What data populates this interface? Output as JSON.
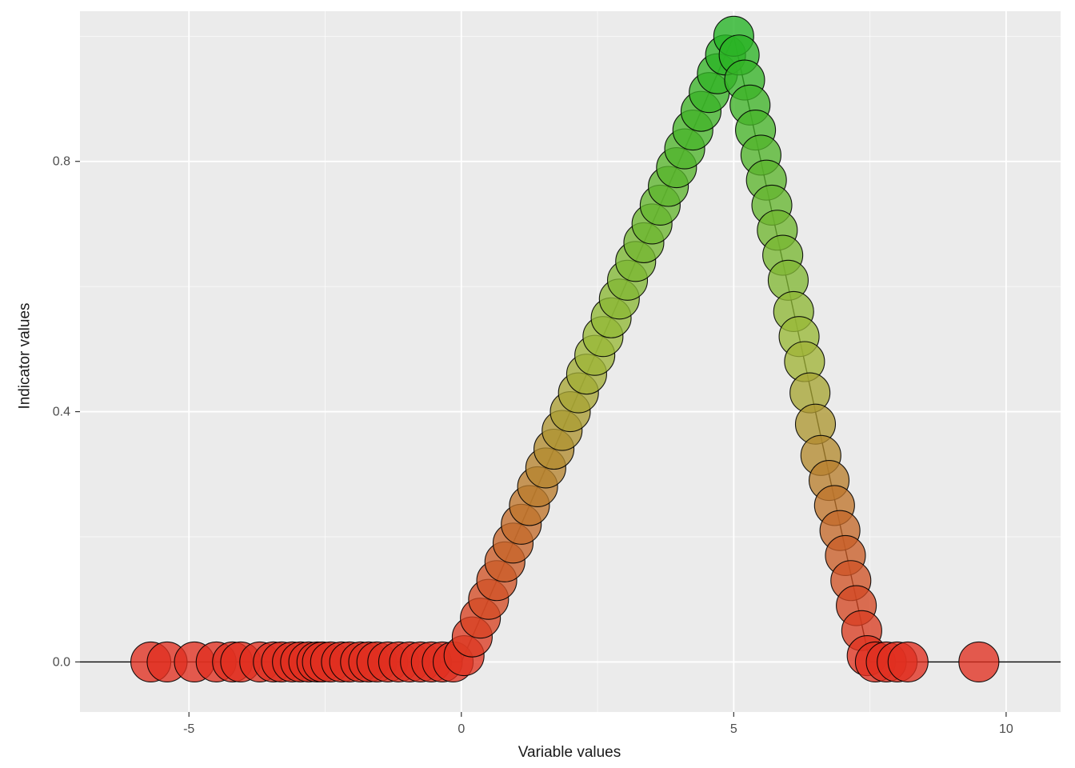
{
  "chart_data": {
    "type": "scatter",
    "xlabel": "Variable values",
    "ylabel": "Indicator values",
    "xlim": [
      -7,
      11
    ],
    "ylim": [
      -0.08,
      1.04
    ],
    "x_ticks": [
      -5,
      0,
      5,
      10
    ],
    "y_ticks": [
      0.0,
      0.4,
      0.8
    ],
    "x_minor": [
      -2.5,
      2.5,
      7.5
    ],
    "y_minor": [
      0.2,
      0.6,
      1.0
    ],
    "line_path": [
      {
        "x": -7,
        "y": 0.0
      },
      {
        "x": 0.0,
        "y": 0.0
      },
      {
        "x": 5.0,
        "y": 1.0
      },
      {
        "x": 7.5,
        "y": 0.0
      },
      {
        "x": 11,
        "y": 0.0
      }
    ],
    "points": [
      {
        "x": -5.7,
        "y": 0.0
      },
      {
        "x": -5.4,
        "y": 0.0
      },
      {
        "x": -4.9,
        "y": 0.0
      },
      {
        "x": -4.5,
        "y": 0.0
      },
      {
        "x": -4.2,
        "y": 0.0
      },
      {
        "x": -4.05,
        "y": 0.0
      },
      {
        "x": -3.7,
        "y": 0.0
      },
      {
        "x": -3.45,
        "y": 0.0
      },
      {
        "x": -3.3,
        "y": 0.0
      },
      {
        "x": -3.1,
        "y": 0.0
      },
      {
        "x": -2.95,
        "y": 0.0
      },
      {
        "x": -2.8,
        "y": 0.0
      },
      {
        "x": -2.65,
        "y": 0.0
      },
      {
        "x": -2.55,
        "y": 0.0
      },
      {
        "x": -2.4,
        "y": 0.0
      },
      {
        "x": -2.2,
        "y": 0.0
      },
      {
        "x": -2.05,
        "y": 0.0
      },
      {
        "x": -1.85,
        "y": 0.0
      },
      {
        "x": -1.7,
        "y": 0.0
      },
      {
        "x": -1.55,
        "y": 0.0
      },
      {
        "x": -1.35,
        "y": 0.0
      },
      {
        "x": -1.15,
        "y": 0.0
      },
      {
        "x": -0.95,
        "y": 0.0
      },
      {
        "x": -0.75,
        "y": 0.0
      },
      {
        "x": -0.55,
        "y": 0.0
      },
      {
        "x": -0.35,
        "y": 0.0
      },
      {
        "x": -0.15,
        "y": 0.0
      },
      {
        "x": 0.05,
        "y": 0.01
      },
      {
        "x": 0.2,
        "y": 0.04
      },
      {
        "x": 0.35,
        "y": 0.07
      },
      {
        "x": 0.5,
        "y": 0.1
      },
      {
        "x": 0.65,
        "y": 0.13
      },
      {
        "x": 0.8,
        "y": 0.16
      },
      {
        "x": 0.95,
        "y": 0.19
      },
      {
        "x": 1.1,
        "y": 0.22
      },
      {
        "x": 1.25,
        "y": 0.25
      },
      {
        "x": 1.4,
        "y": 0.28
      },
      {
        "x": 1.55,
        "y": 0.31
      },
      {
        "x": 1.7,
        "y": 0.34
      },
      {
        "x": 1.85,
        "y": 0.37
      },
      {
        "x": 2.0,
        "y": 0.4
      },
      {
        "x": 2.15,
        "y": 0.43
      },
      {
        "x": 2.3,
        "y": 0.46
      },
      {
        "x": 2.45,
        "y": 0.49
      },
      {
        "x": 2.6,
        "y": 0.52
      },
      {
        "x": 2.75,
        "y": 0.55
      },
      {
        "x": 2.9,
        "y": 0.58
      },
      {
        "x": 3.05,
        "y": 0.61
      },
      {
        "x": 3.2,
        "y": 0.64
      },
      {
        "x": 3.35,
        "y": 0.67
      },
      {
        "x": 3.5,
        "y": 0.7
      },
      {
        "x": 3.65,
        "y": 0.73
      },
      {
        "x": 3.8,
        "y": 0.76
      },
      {
        "x": 3.95,
        "y": 0.79
      },
      {
        "x": 4.1,
        "y": 0.82
      },
      {
        "x": 4.25,
        "y": 0.85
      },
      {
        "x": 4.4,
        "y": 0.88
      },
      {
        "x": 4.55,
        "y": 0.91
      },
      {
        "x": 4.7,
        "y": 0.94
      },
      {
        "x": 4.85,
        "y": 0.97
      },
      {
        "x": 5.0,
        "y": 1.0
      },
      {
        "x": 5.1,
        "y": 0.97
      },
      {
        "x": 5.2,
        "y": 0.93
      },
      {
        "x": 5.3,
        "y": 0.89
      },
      {
        "x": 5.4,
        "y": 0.85
      },
      {
        "x": 5.5,
        "y": 0.81
      },
      {
        "x": 5.6,
        "y": 0.77
      },
      {
        "x": 5.7,
        "y": 0.73
      },
      {
        "x": 5.8,
        "y": 0.69
      },
      {
        "x": 5.9,
        "y": 0.65
      },
      {
        "x": 6.0,
        "y": 0.61
      },
      {
        "x": 6.1,
        "y": 0.56
      },
      {
        "x": 6.2,
        "y": 0.52
      },
      {
        "x": 6.3,
        "y": 0.48
      },
      {
        "x": 6.4,
        "y": 0.43
      },
      {
        "x": 6.5,
        "y": 0.38
      },
      {
        "x": 6.6,
        "y": 0.33
      },
      {
        "x": 6.75,
        "y": 0.29
      },
      {
        "x": 6.85,
        "y": 0.25
      },
      {
        "x": 6.95,
        "y": 0.21
      },
      {
        "x": 7.05,
        "y": 0.17
      },
      {
        "x": 7.15,
        "y": 0.13
      },
      {
        "x": 7.25,
        "y": 0.09
      },
      {
        "x": 7.35,
        "y": 0.05
      },
      {
        "x": 7.45,
        "y": 0.01
      },
      {
        "x": 7.6,
        "y": 0.0
      },
      {
        "x": 7.8,
        "y": 0.0
      },
      {
        "x": 8.0,
        "y": 0.0
      },
      {
        "x": 8.2,
        "y": 0.0
      },
      {
        "x": 9.5,
        "y": 0.0
      }
    ],
    "color_scale": {
      "low": "#E03020",
      "mid": "#9DB838",
      "high": "#24B324"
    },
    "point_radius_px": 25
  }
}
